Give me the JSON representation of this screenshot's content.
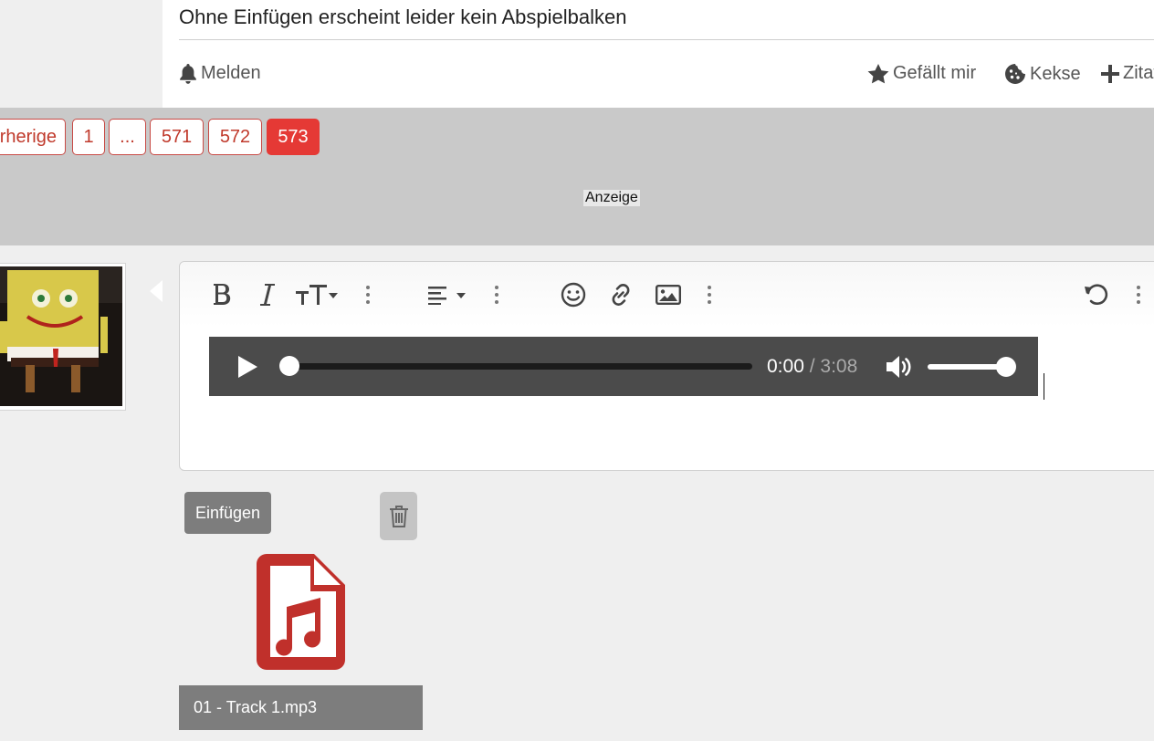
{
  "post": {
    "text": "Ohne Einfügen erscheint leider kein Abspielbalken",
    "actions": {
      "report": "Melden",
      "like": "Gefällt mir",
      "cookies": "Kekse",
      "quote": "Zitat"
    }
  },
  "pagination": {
    "previous": "Vorherige",
    "pages": [
      "1",
      "...",
      "571",
      "572",
      "573"
    ],
    "current": "573",
    "accent_color": "#e53935"
  },
  "ad": {
    "label": "Anzeige"
  },
  "editor": {
    "toolbar": [
      "bold-icon",
      "italic-icon",
      "text-size-icon",
      "more-icon",
      "align-icon",
      "more-icon",
      "smiley-icon",
      "link-icon",
      "image-icon",
      "more-icon",
      "undo-icon",
      "more-icon"
    ],
    "audio": {
      "current_time": "0:00",
      "separator": "/",
      "duration": "3:08",
      "progress": 0.0,
      "volume": 1.0
    }
  },
  "attachment": {
    "insert_label": "Einfügen",
    "file_name": "01 - Track 1.mp3",
    "icon": "file-audio-icon",
    "icon_color": "#c0302b"
  }
}
